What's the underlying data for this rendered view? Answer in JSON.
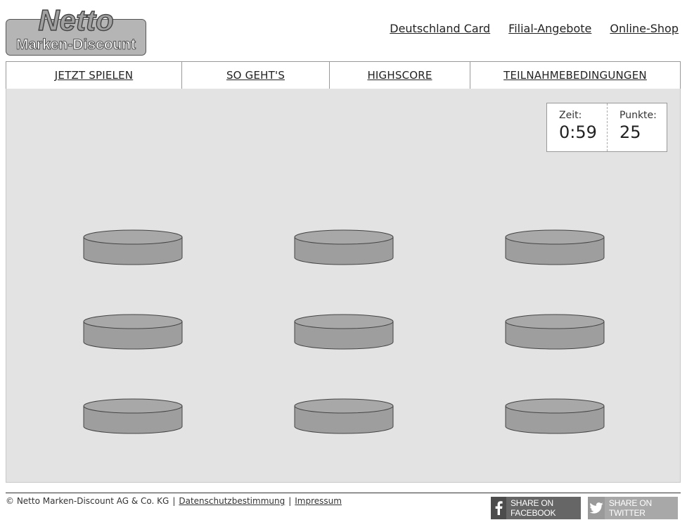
{
  "brand": {
    "logo_line1": "Netto",
    "logo_line2": "Marken-Discount"
  },
  "toplinks": [
    {
      "label": "Deutschland Card"
    },
    {
      "label": "Filial-Angebote"
    },
    {
      "label": "Online-Shop"
    }
  ],
  "nav": {
    "tabs": [
      {
        "label": "JETZT SPIELEN"
      },
      {
        "label": "SO GEHT'S"
      },
      {
        "label": "HIGHSCORE"
      },
      {
        "label": "TEILNAHMEBEDINGUNGEN"
      }
    ]
  },
  "score": {
    "time_label": "Zeit:",
    "time_value": "0:59",
    "points_label": "Punkte:",
    "points_value": "25"
  },
  "board": {
    "rows": 3,
    "cols": 3
  },
  "footer": {
    "copyright": "© Netto Marken-Discount AG & Co. KG",
    "separator": "|",
    "privacy": "Datenschutzbestimmung",
    "imprint": "Impressum"
  },
  "share": {
    "facebook": "Share on Facebook",
    "twitter": "Share on Twitter"
  },
  "colors": {
    "board_bg": "#e3e3e3",
    "hole_fill": "#9e9e9e",
    "hole_top": "#a8a8a8"
  }
}
